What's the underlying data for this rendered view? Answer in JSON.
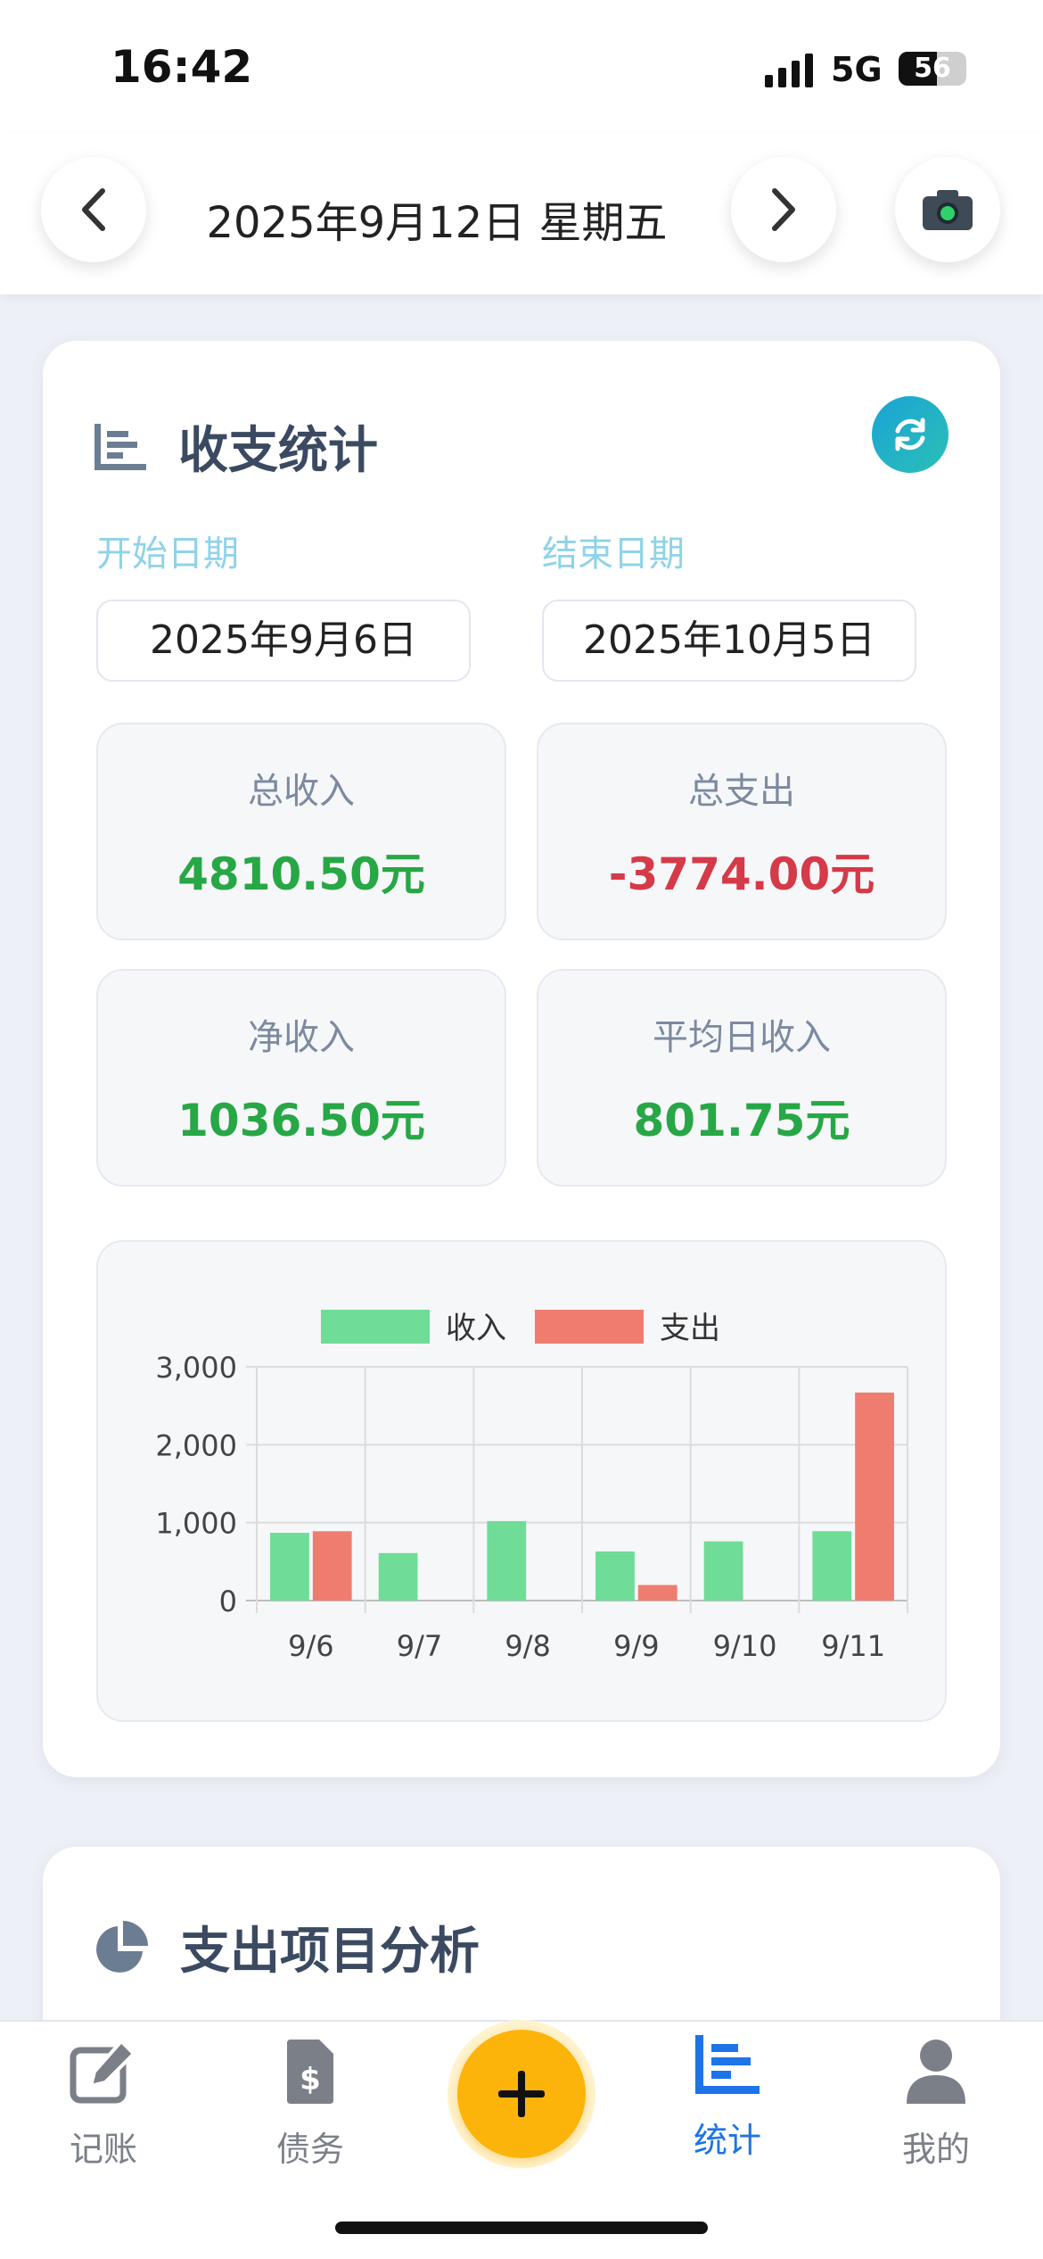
{
  "status": {
    "time": "16:42",
    "network": "5G",
    "battery": "56",
    "battery_level": 0.56
  },
  "header": {
    "date": "2025年9月12日 星期五"
  },
  "stats_card": {
    "title": "收支统计",
    "start_label": "开始日期",
    "end_label": "结束日期",
    "start_date": "2025年9月6日",
    "end_date": "2025年10月5日",
    "total_income_label": "总收入",
    "total_income": "4810.50元",
    "total_expense_label": "总支出",
    "total_expense": "-3774.00元",
    "net_income_label": "净收入",
    "net_income": "1036.50元",
    "avg_income_label": "平均日收入",
    "avg_income": "801.75元"
  },
  "chart_data": {
    "type": "bar",
    "categories": [
      "9/6",
      "9/7",
      "9/8",
      "9/9",
      "9/10",
      "9/11"
    ],
    "series": [
      {
        "name": "收入",
        "color": "#6fdc97",
        "values": [
          870,
          610,
          1020,
          630,
          760,
          890
        ]
      },
      {
        "name": "支出",
        "color": "#ee7d70",
        "values": [
          890,
          0,
          0,
          200,
          0,
          2670
        ]
      }
    ],
    "ylim": [
      0,
      3000
    ],
    "yticks": [
      "0",
      "1,000",
      "2,000",
      "3,000"
    ],
    "ytick_values": [
      0,
      1000,
      2000,
      3000
    ],
    "legend": "top-center",
    "grid": true
  },
  "analysis_card": {
    "title": "支出项目分析"
  },
  "tabbar": {
    "record": "记账",
    "debt": "债务",
    "stats": "统计",
    "mine": "我的"
  },
  "colors": {
    "accent": "#1e73e6",
    "fab": "#fcb40b",
    "income": "#27a745",
    "expense": "#d53a48"
  }
}
